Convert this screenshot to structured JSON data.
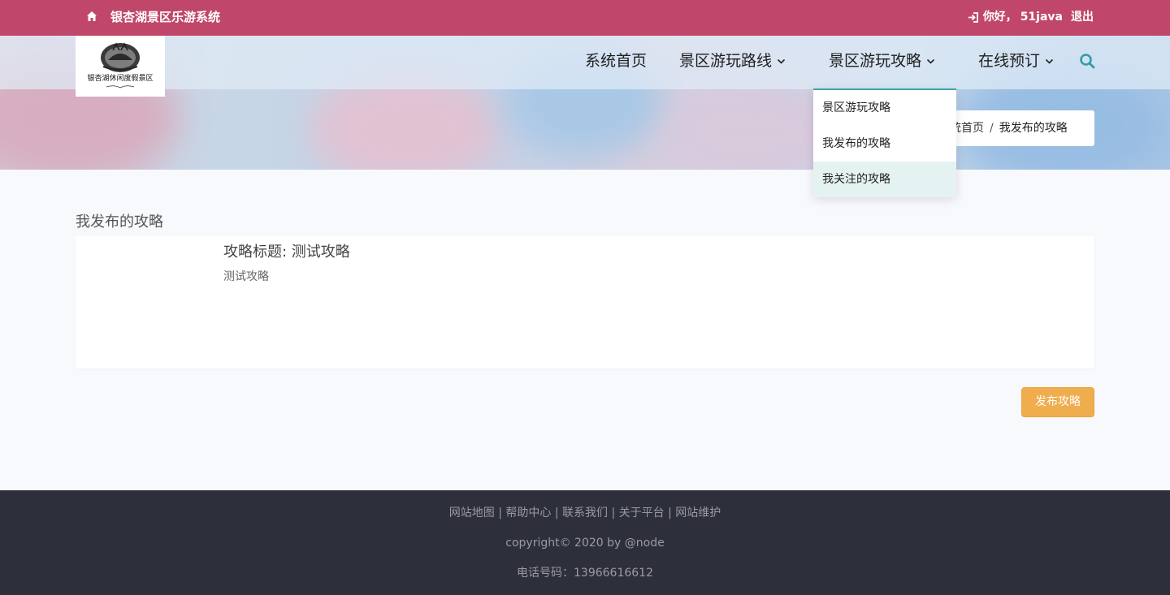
{
  "topbar": {
    "site_name": "银杏湖景区乐游系统",
    "greeting": "你好，",
    "username": "51java",
    "logout_label": "退出"
  },
  "logo": {
    "text_cn": "银杏湖休闲度假景区"
  },
  "nav": {
    "items": [
      {
        "label": "系统首页"
      },
      {
        "label": "景区游玩路线"
      },
      {
        "label": "景区游玩攻略"
      },
      {
        "label": "在线预订"
      }
    ]
  },
  "dropdown": {
    "items": [
      {
        "label": "景区游玩攻略"
      },
      {
        "label": "我发布的攻略"
      },
      {
        "label": "我关注的攻略"
      }
    ]
  },
  "breadcrumb": {
    "home": "系统首页",
    "separator": "/",
    "current": "我发布的攻略"
  },
  "main": {
    "section_title": "我发布的攻略",
    "card": {
      "title": "攻略标题: 测试攻略",
      "description": "测试攻略"
    },
    "publish_button": "发布攻略"
  },
  "footer": {
    "links": [
      "网站地图",
      "帮助中心",
      "联系我们",
      "关于平台",
      "网站维护"
    ],
    "link_separator": "|",
    "copyright": "copyright© 2020 by @node",
    "phone": "电话号码：13966616612"
  },
  "colors": {
    "topbar": "#c0476a",
    "accent": "#3aa6a6",
    "button": "#f0ad4e",
    "footer": "#2d2f3b"
  }
}
